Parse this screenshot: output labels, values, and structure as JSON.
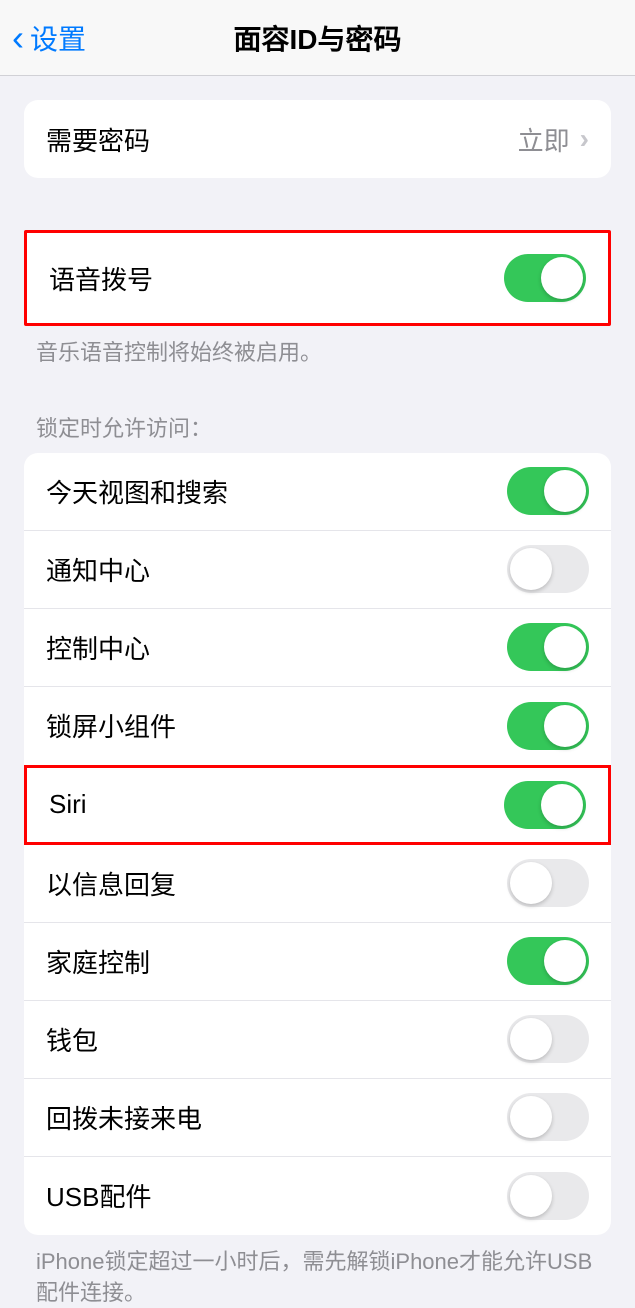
{
  "nav": {
    "back": "设置",
    "title": "面容ID与密码"
  },
  "passcode_group": {
    "require_passcode_label": "需要密码",
    "require_passcode_value": "立即"
  },
  "voice_dial": {
    "label": "语音拨号",
    "on": true,
    "footer": "音乐语音控制将始终被启用。"
  },
  "lock_access": {
    "header": "锁定时允许访问：",
    "items": [
      {
        "label": "今天视图和搜索",
        "on": true
      },
      {
        "label": "通知中心",
        "on": false
      },
      {
        "label": "控制中心",
        "on": true
      },
      {
        "label": "锁屏小组件",
        "on": true
      },
      {
        "label": "Siri",
        "on": true
      },
      {
        "label": "以信息回复",
        "on": false
      },
      {
        "label": "家庭控制",
        "on": true
      },
      {
        "label": "钱包",
        "on": false
      },
      {
        "label": "回拨未接来电",
        "on": false
      },
      {
        "label": "USB配件",
        "on": false
      }
    ],
    "footer": "iPhone锁定超过一小时后，需先解锁iPhone才能允许USB配件连接。"
  }
}
